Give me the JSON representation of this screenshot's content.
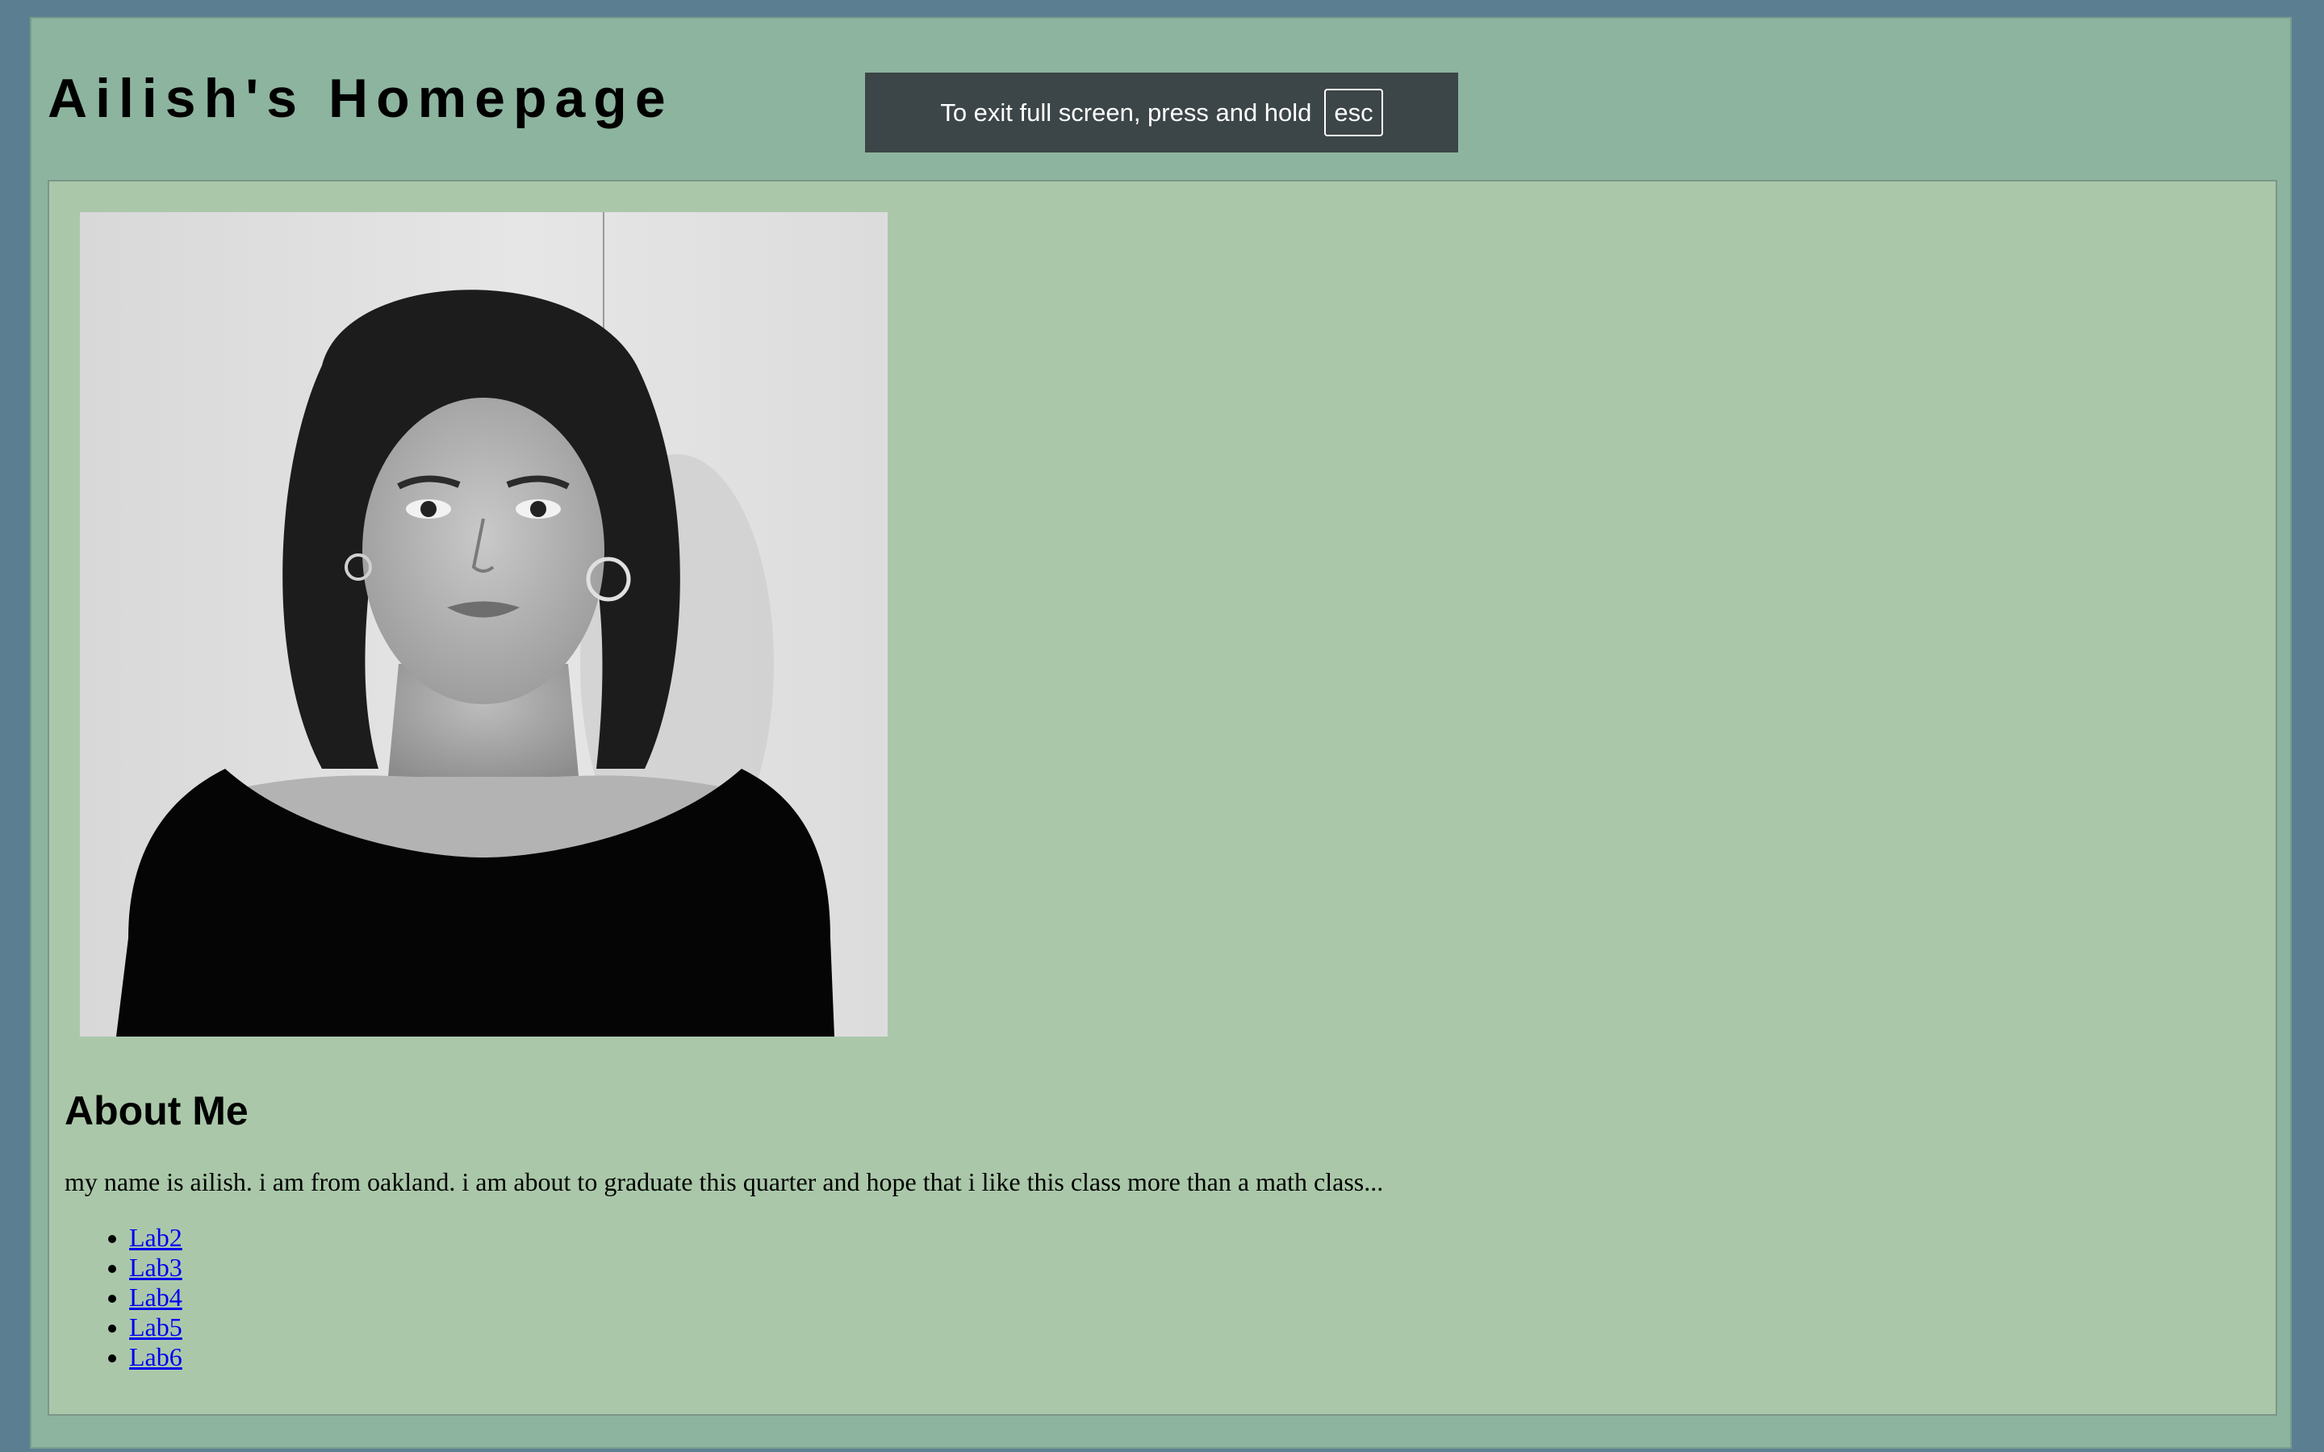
{
  "header": {
    "title": "Ailish's Homepage"
  },
  "fullscreen_banner": {
    "message": "To exit full screen, press and hold",
    "key": "esc"
  },
  "profile": {
    "photo_description": "portrait-photo"
  },
  "about": {
    "heading": "About Me",
    "text": "my name is ailish. i am from oakland. i am about to graduate this quarter and hope that i like this class more than a math class..."
  },
  "labs": [
    {
      "label": "Lab2"
    },
    {
      "label": "Lab3"
    },
    {
      "label": "Lab4"
    },
    {
      "label": "Lab5"
    },
    {
      "label": "Lab6"
    }
  ],
  "colors": {
    "page_background": "#5b7f91",
    "outer_panel": "#8db49f",
    "content_panel": "#aac8a9",
    "banner_background": "#3c4547",
    "link": "#0000ee"
  }
}
